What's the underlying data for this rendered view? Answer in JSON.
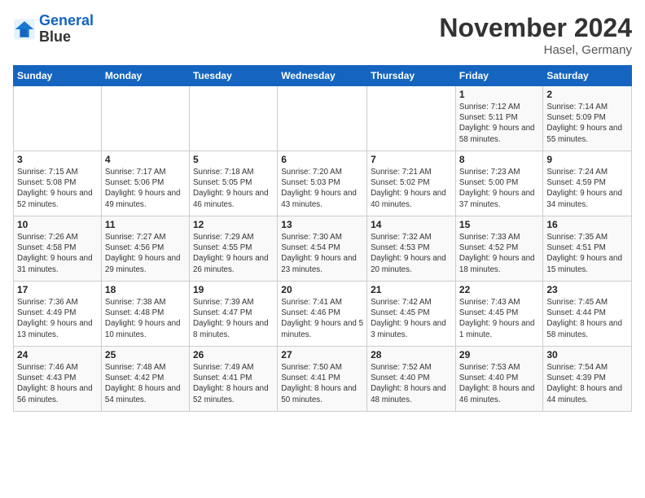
{
  "logo": {
    "line1": "General",
    "line2": "Blue"
  },
  "title": "November 2024",
  "subtitle": "Hasel, Germany",
  "weekdays": [
    "Sunday",
    "Monday",
    "Tuesday",
    "Wednesday",
    "Thursday",
    "Friday",
    "Saturday"
  ],
  "weeks": [
    [
      {
        "day": "",
        "info": ""
      },
      {
        "day": "",
        "info": ""
      },
      {
        "day": "",
        "info": ""
      },
      {
        "day": "",
        "info": ""
      },
      {
        "day": "",
        "info": ""
      },
      {
        "day": "1",
        "info": "Sunrise: 7:12 AM\nSunset: 5:11 PM\nDaylight: 9 hours and 58 minutes."
      },
      {
        "day": "2",
        "info": "Sunrise: 7:14 AM\nSunset: 5:09 PM\nDaylight: 9 hours and 55 minutes."
      }
    ],
    [
      {
        "day": "3",
        "info": "Sunrise: 7:15 AM\nSunset: 5:08 PM\nDaylight: 9 hours and 52 minutes."
      },
      {
        "day": "4",
        "info": "Sunrise: 7:17 AM\nSunset: 5:06 PM\nDaylight: 9 hours and 49 minutes."
      },
      {
        "day": "5",
        "info": "Sunrise: 7:18 AM\nSunset: 5:05 PM\nDaylight: 9 hours and 46 minutes."
      },
      {
        "day": "6",
        "info": "Sunrise: 7:20 AM\nSunset: 5:03 PM\nDaylight: 9 hours and 43 minutes."
      },
      {
        "day": "7",
        "info": "Sunrise: 7:21 AM\nSunset: 5:02 PM\nDaylight: 9 hours and 40 minutes."
      },
      {
        "day": "8",
        "info": "Sunrise: 7:23 AM\nSunset: 5:00 PM\nDaylight: 9 hours and 37 minutes."
      },
      {
        "day": "9",
        "info": "Sunrise: 7:24 AM\nSunset: 4:59 PM\nDaylight: 9 hours and 34 minutes."
      }
    ],
    [
      {
        "day": "10",
        "info": "Sunrise: 7:26 AM\nSunset: 4:58 PM\nDaylight: 9 hours and 31 minutes."
      },
      {
        "day": "11",
        "info": "Sunrise: 7:27 AM\nSunset: 4:56 PM\nDaylight: 9 hours and 29 minutes."
      },
      {
        "day": "12",
        "info": "Sunrise: 7:29 AM\nSunset: 4:55 PM\nDaylight: 9 hours and 26 minutes."
      },
      {
        "day": "13",
        "info": "Sunrise: 7:30 AM\nSunset: 4:54 PM\nDaylight: 9 hours and 23 minutes."
      },
      {
        "day": "14",
        "info": "Sunrise: 7:32 AM\nSunset: 4:53 PM\nDaylight: 9 hours and 20 minutes."
      },
      {
        "day": "15",
        "info": "Sunrise: 7:33 AM\nSunset: 4:52 PM\nDaylight: 9 hours and 18 minutes."
      },
      {
        "day": "16",
        "info": "Sunrise: 7:35 AM\nSunset: 4:51 PM\nDaylight: 9 hours and 15 minutes."
      }
    ],
    [
      {
        "day": "17",
        "info": "Sunrise: 7:36 AM\nSunset: 4:49 PM\nDaylight: 9 hours and 13 minutes."
      },
      {
        "day": "18",
        "info": "Sunrise: 7:38 AM\nSunset: 4:48 PM\nDaylight: 9 hours and 10 minutes."
      },
      {
        "day": "19",
        "info": "Sunrise: 7:39 AM\nSunset: 4:47 PM\nDaylight: 9 hours and 8 minutes."
      },
      {
        "day": "20",
        "info": "Sunrise: 7:41 AM\nSunset: 4:46 PM\nDaylight: 9 hours and 5 minutes."
      },
      {
        "day": "21",
        "info": "Sunrise: 7:42 AM\nSunset: 4:45 PM\nDaylight: 9 hours and 3 minutes."
      },
      {
        "day": "22",
        "info": "Sunrise: 7:43 AM\nSunset: 4:45 PM\nDaylight: 9 hours and 1 minute."
      },
      {
        "day": "23",
        "info": "Sunrise: 7:45 AM\nSunset: 4:44 PM\nDaylight: 8 hours and 58 minutes."
      }
    ],
    [
      {
        "day": "24",
        "info": "Sunrise: 7:46 AM\nSunset: 4:43 PM\nDaylight: 8 hours and 56 minutes."
      },
      {
        "day": "25",
        "info": "Sunrise: 7:48 AM\nSunset: 4:42 PM\nDaylight: 8 hours and 54 minutes."
      },
      {
        "day": "26",
        "info": "Sunrise: 7:49 AM\nSunset: 4:41 PM\nDaylight: 8 hours and 52 minutes."
      },
      {
        "day": "27",
        "info": "Sunrise: 7:50 AM\nSunset: 4:41 PM\nDaylight: 8 hours and 50 minutes."
      },
      {
        "day": "28",
        "info": "Sunrise: 7:52 AM\nSunset: 4:40 PM\nDaylight: 8 hours and 48 minutes."
      },
      {
        "day": "29",
        "info": "Sunrise: 7:53 AM\nSunset: 4:40 PM\nDaylight: 8 hours and 46 minutes."
      },
      {
        "day": "30",
        "info": "Sunrise: 7:54 AM\nSunset: 4:39 PM\nDaylight: 8 hours and 44 minutes."
      }
    ]
  ]
}
